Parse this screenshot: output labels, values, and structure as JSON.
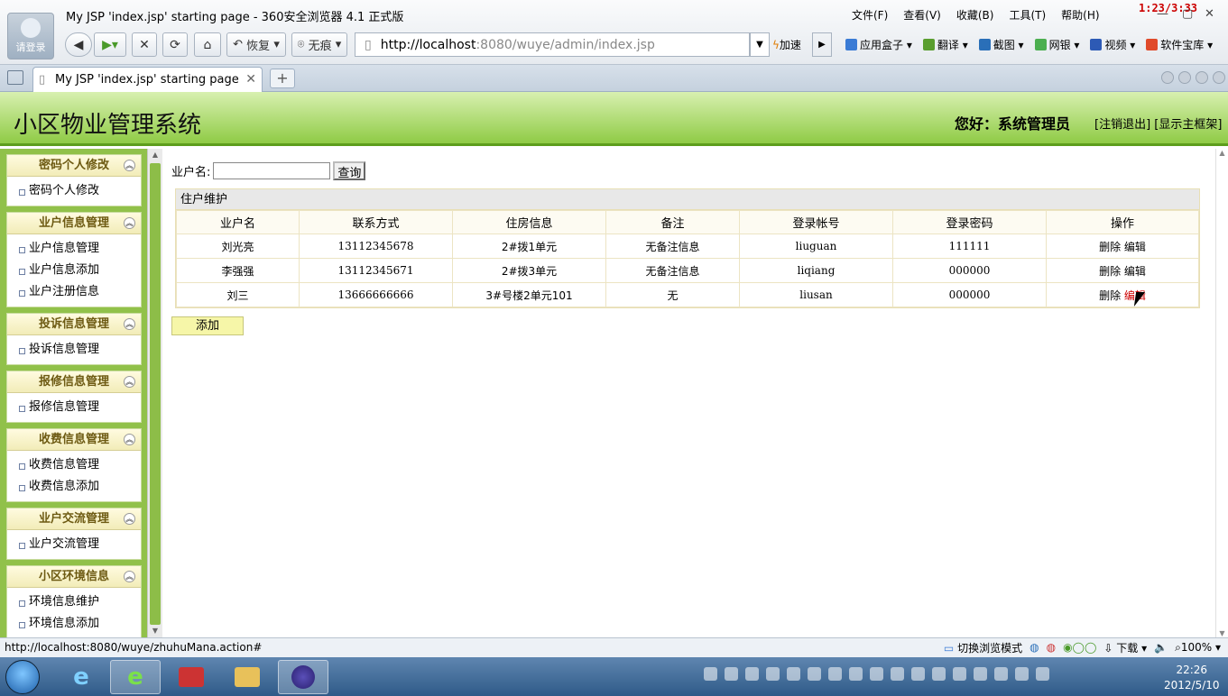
{
  "browser": {
    "window_title": "My JSP 'index.jsp' starting page - 360安全浏览器 4.1 正式版",
    "login_label": "请登录",
    "menu": [
      "文件(F)",
      "查看(V)",
      "收藏(B)",
      "工具(T)",
      "帮助(H)"
    ],
    "timer": "1:23/3:33",
    "restore_label": "恢复",
    "incognito_label": "无痕",
    "address": {
      "host": "http://localhost",
      "rest": ":8080/wuye/admin/index.jsp"
    },
    "speed_label": "加速",
    "toolbar_tools": [
      {
        "label": "应用盒子",
        "icon": "app-box-icon",
        "color": "#3a7bd5"
      },
      {
        "label": "翻译",
        "icon": "translate-icon",
        "color": "#5a9e2f"
      },
      {
        "label": "截图",
        "icon": "screenshot-icon",
        "color": "#2a6fb8"
      },
      {
        "label": "网银",
        "icon": "bank-icon",
        "color": "#4caf50"
      },
      {
        "label": "视频",
        "icon": "video-icon",
        "color": "#2d5ab5"
      },
      {
        "label": "软件宝库",
        "icon": "software-icon",
        "color": "#e04a2a"
      }
    ],
    "tab_title": "My JSP 'index.jsp' starting page",
    "status_url": "http://localhost:8080/wuye/zhuhuMana.action#",
    "status_right": {
      "mode": "切换浏览模式",
      "download": "下载",
      "zoom": "100%"
    }
  },
  "app": {
    "title": "小区物业管理系统",
    "greeting": "您好：系统管理员",
    "logout": "[注销退出]",
    "show_frame": "[显示主框架]"
  },
  "sidebar": [
    {
      "title": "密码个人修改",
      "items": [
        "密码个人修改"
      ]
    },
    {
      "title": "业户信息管理",
      "items": [
        "业户信息管理",
        "业户信息添加",
        "业户注册信息"
      ]
    },
    {
      "title": "投诉信息管理",
      "items": [
        "投诉信息管理"
      ]
    },
    {
      "title": "报修信息管理",
      "items": [
        "报修信息管理"
      ]
    },
    {
      "title": "收费信息管理",
      "items": [
        "收费信息管理",
        "收费信息添加"
      ]
    },
    {
      "title": "业户交流管理",
      "items": [
        "业户交流管理"
      ]
    },
    {
      "title": "小区环境信息",
      "items": [
        "环境信息维护",
        "环境信息添加"
      ]
    }
  ],
  "search": {
    "label": "业户名:",
    "value": "",
    "button": "查询"
  },
  "table": {
    "caption": "住户维护",
    "columns": [
      "业户名",
      "联系方式",
      "住房信息",
      "备注",
      "登录帐号",
      "登录密码",
      "操作"
    ],
    "rows": [
      {
        "name": "刘光亮",
        "phone": "13112345678",
        "house": "2#拨1单元",
        "note": "无备注信息",
        "account": "liuguan",
        "password": "111111"
      },
      {
        "name": "李强强",
        "phone": "13112345671",
        "house": "2#拨3单元",
        "note": "无备注信息",
        "account": "liqiang",
        "password": "000000"
      },
      {
        "name": "刘三",
        "phone": "13666666666",
        "house": "3#号楼2单元101",
        "note": "无",
        "account": "liusan",
        "password": "000000"
      }
    ],
    "delete_label": "删除",
    "edit_label": "编辑"
  },
  "add_button": "添加",
  "taskbar": {
    "time": "22:26",
    "date": "2012/5/10"
  }
}
